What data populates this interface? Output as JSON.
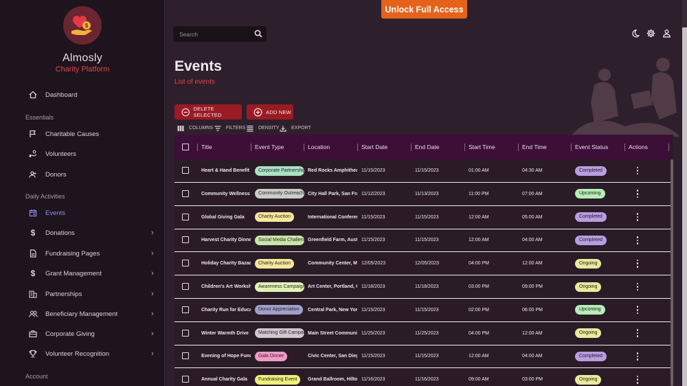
{
  "brand": {
    "name": "Almosly",
    "subtitle": "Charity Platform"
  },
  "topbar": {
    "search_placeholder": "Search",
    "unlock_label": "Unlock Full Access"
  },
  "sidebar": {
    "dashboard": "Dashboard",
    "sections": [
      "Essentials",
      "Daily Activities",
      "Account"
    ],
    "essentials": [
      {
        "label": "Charitable Causes",
        "icon": "flag-icon"
      },
      {
        "label": "Volunteers",
        "icon": "volunteer-icon"
      },
      {
        "label": "Donors",
        "icon": "donor-icon"
      }
    ],
    "daily": [
      {
        "label": "Events",
        "icon": "calendar-icon",
        "active": true
      },
      {
        "label": "Donations",
        "icon": "dollar-icon",
        "chevron": true
      },
      {
        "label": "Fundraising Pages",
        "icon": "page-icon",
        "chevron": true
      },
      {
        "label": "Grant Management",
        "icon": "dollar-icon",
        "chevron": true
      },
      {
        "label": "Partnerships",
        "icon": "building-icon",
        "chevron": true
      },
      {
        "label": "Beneficiary Management",
        "icon": "people-icon",
        "chevron": true
      },
      {
        "label": "Corporate Giving",
        "icon": "briefcase-icon",
        "chevron": true
      },
      {
        "label": "Volunteer Recognition",
        "icon": "trophy-icon",
        "chevron": true
      }
    ]
  },
  "page": {
    "title": "Events",
    "subtitle": "List of events"
  },
  "actions": {
    "delete_label": "DELETE SELECTED",
    "add_label": "ADD NEW"
  },
  "toolbar": {
    "columns": "COLUMNS",
    "filters": "FILTERS",
    "density": "DENSITY",
    "export": "EXPORT"
  },
  "table": {
    "headers": [
      "Title",
      "Event Type",
      "Location",
      "Start Date",
      "End Date",
      "Start Time",
      "End Time",
      "Event Status",
      "Actions"
    ],
    "rows": [
      {
        "title": "Heart & Hand Benefit",
        "type": "Corporate Partnership",
        "type_color": "#a9e3c4",
        "location": "Red Rocks Amphitheatre",
        "start": "11/15/2023",
        "end": "11/15/2023",
        "stime": "01:00 AM",
        "etime": "04:30 AM",
        "status": "Completed",
        "status_color": "#b89de0"
      },
      {
        "title": "Community Wellness",
        "type": "Community Outreach",
        "type_color": "#c9cdc7",
        "location": "City Hall Park, San Francisco",
        "start": "11/12/2023",
        "end": "11/13/2023",
        "stime": "11:00 PM",
        "etime": "07:00 AM",
        "status": "Upcoming",
        "status_color": "#b7edb7"
      },
      {
        "title": "Global Giving Gala",
        "type": "Charity Auction",
        "type_color": "#f4e79a",
        "location": "International Conference",
        "start": "11/15/2023",
        "end": "11/15/2023",
        "stime": "12:00 AM",
        "etime": "05:00 AM",
        "status": "Completed",
        "status_color": "#b89de0"
      },
      {
        "title": "Harvest Charity Dinner",
        "type": "Social Media Challenge",
        "type_color": "#c7e7a7",
        "location": "Greenfield Farm, Austin",
        "start": "11/15/2023",
        "end": "11/15/2023",
        "stime": "12:00 AM",
        "etime": "04:00 AM",
        "status": "Completed",
        "status_color": "#b89de0"
      },
      {
        "title": "Holiday Charity Bazaar",
        "type": "Charity Auction",
        "type_color": "#f4e79a",
        "location": "Community Center, Miami",
        "start": "12/05/2023",
        "end": "12/05/2023",
        "stime": "04:00 PM",
        "etime": "12:00 AM",
        "status": "Ongoing",
        "status_color": "#eaea9c"
      },
      {
        "title": "Children's Art Workshop",
        "type": "Awareness Campaign",
        "type_color": "#dff3b4",
        "location": "Art Center, Portland, OR",
        "start": "11/18/2023",
        "end": "11/18/2023",
        "stime": "03:00 PM",
        "etime": "09:00 PM",
        "status": "Ongoing",
        "status_color": "#eaea9c"
      },
      {
        "title": "Charity Run for Education",
        "type": "Donor Appreciation",
        "type_color": "#9fa0c7",
        "location": "Central Park, New York",
        "start": "11/15/2023",
        "end": "11/15/2023",
        "stime": "02:00 PM",
        "etime": "06:00 PM",
        "status": "Upcoming",
        "status_color": "#b7edb7"
      },
      {
        "title": "Winter Warmth Drive",
        "type": "Matching Gift Campaign",
        "type_color": "#cfc8ce",
        "location": "Main Street Community",
        "start": "11/25/2023",
        "end": "11/25/2023",
        "stime": "04:00 PM",
        "etime": "12:00 AM",
        "status": "Ongoing",
        "status_color": "#eaea9c"
      },
      {
        "title": "Evening of Hope Fundraiser",
        "type": "Gala Dinner",
        "type_color": "#f09ac6",
        "location": "Civic Center, San Diego",
        "start": "11/15/2023",
        "end": "11/15/2023",
        "stime": "12:00 AM",
        "etime": "04:00 AM",
        "status": "Completed",
        "status_color": "#b89de0"
      },
      {
        "title": "Annual Charity Gala",
        "type": "Fundraising Event",
        "type_color": "#ecf07a",
        "location": "Grand Ballroom, Hilton",
        "start": "11/16/2023",
        "end": "11/16/2023",
        "stime": "09:00 AM",
        "etime": "03:00 PM",
        "status": "Ongoing",
        "status_color": "#eaea9c"
      }
    ]
  },
  "colors": {
    "accent": "#9a1b24",
    "unlock": "#e5621b",
    "header_bg": "#3d0f38",
    "sidebar_bg": "#1e141d",
    "active_nav": "#8c8cf0",
    "subtitle_red": "#e0444d"
  }
}
